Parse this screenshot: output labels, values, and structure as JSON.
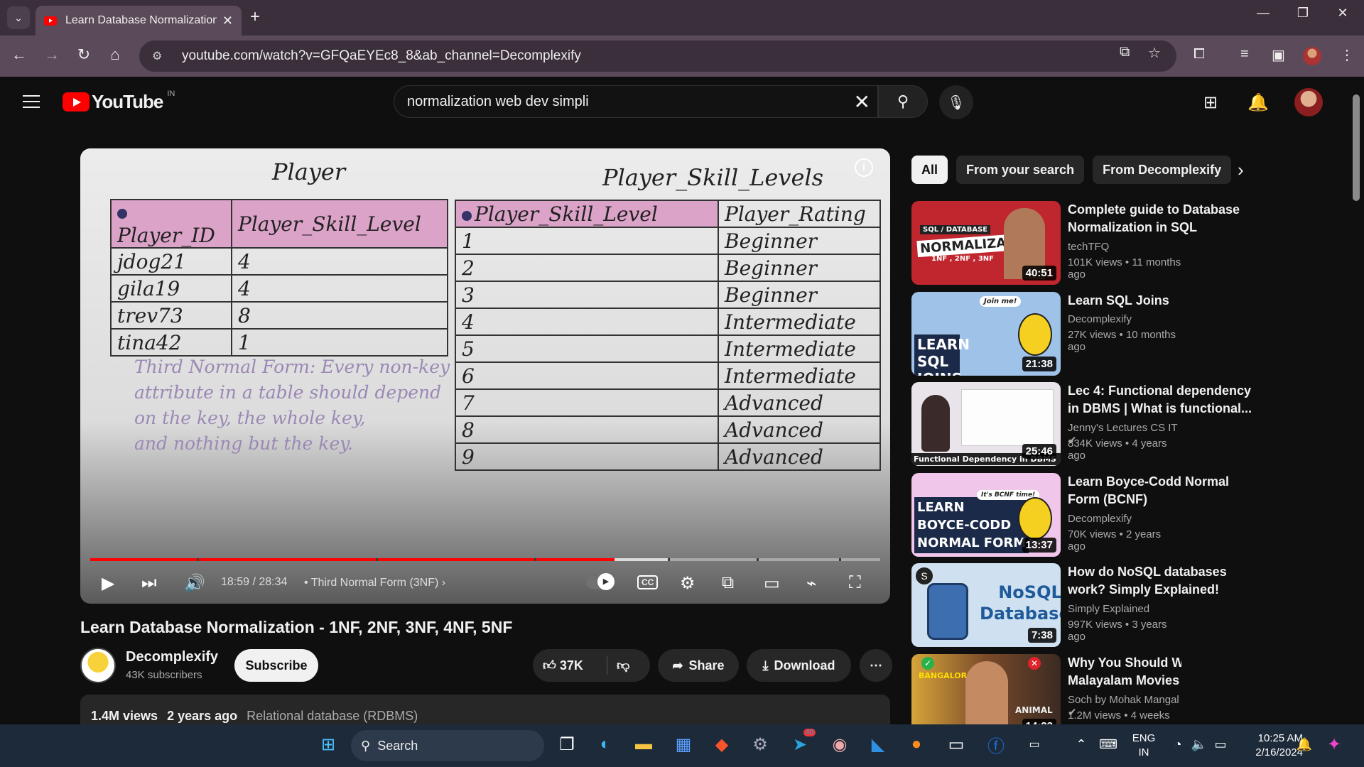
{
  "browser": {
    "tab_title": "Learn Database Normalization -",
    "url": "youtube.com/watch?v=GFQaEYEc8_8&ab_channel=Decomplexify"
  },
  "header": {
    "logo_text": "YouTube",
    "country": "IN",
    "search_value": "normalization web dev simpli"
  },
  "video": {
    "slide": {
      "left_title": "Player",
      "right_title": "Player_Skill_Levels",
      "left_headers": [
        "Player_ID",
        "Player_Skill_Level"
      ],
      "left_rows": [
        [
          "jdog21",
          "4"
        ],
        [
          "gila19",
          "4"
        ],
        [
          "trev73",
          "8"
        ],
        [
          "tina42",
          "1"
        ]
      ],
      "right_headers": [
        "Player_Skill_Level",
        "Player_Rating"
      ],
      "right_rows": [
        [
          "1",
          "Beginner"
        ],
        [
          "2",
          "Beginner"
        ],
        [
          "3",
          "Beginner"
        ],
        [
          "4",
          "Intermediate"
        ],
        [
          "5",
          "Intermediate"
        ],
        [
          "6",
          "Intermediate"
        ],
        [
          "7",
          "Advanced"
        ],
        [
          "8",
          "Advanced"
        ],
        [
          "9",
          "Advanced"
        ]
      ],
      "nf_text": [
        "Third Normal Form: Every non-key",
        "attribute in a table should depend",
        "on the key, the whole key,",
        "and nothing but the key."
      ]
    },
    "time": "18:59 / 28:34",
    "chapter": "• Third Normal Form (3NF)",
    "cc_label": "CC",
    "progress_played": 0.664,
    "progress_loaded": 0.732
  },
  "meta": {
    "title": "Learn Database Normalization - 1NF, 2NF, 3NF, 4NF, 5NF",
    "channel": "Decomplexify",
    "subscribers": "43K subscribers",
    "subscribe_label": "Subscribe",
    "likes": "37K",
    "share_label": "Share",
    "download_label": "Download",
    "views": "1.4M views",
    "age": "2 years ago",
    "tag": "Relational database (RDBMS)"
  },
  "chips": [
    "All",
    "From your search",
    "From Decomplexify"
  ],
  "recommendations": [
    {
      "title": "Complete guide to Database Normalization in SQL",
      "channel": "techTFQ",
      "verified": false,
      "views": "101K views",
      "age": "11 months ago",
      "duration": "40:51",
      "thumb_text": [
        "SQL / DATABASE",
        "NORMALIZATION",
        "1NF , 2NF , 3NF"
      ],
      "thumb_color": "#c0262d"
    },
    {
      "title": "Learn SQL Joins",
      "channel": "Decomplexify",
      "verified": false,
      "views": "27K views",
      "age": "10 months ago",
      "duration": "21:38",
      "thumb_text": [
        "LEARN",
        "SQL JOINS",
        "Join me!"
      ],
      "thumb_color": "#9fc3e8"
    },
    {
      "title": "Lec 4: Functional dependency in DBMS | What is functional...",
      "channel": "Jenny's Lectures CS IT",
      "verified": true,
      "views": "834K views",
      "age": "4 years ago",
      "duration": "25:46",
      "thumb_text": [
        "Functional Dependency in DBMS"
      ],
      "thumb_color": "#e9e4ea"
    },
    {
      "title": "Learn Boyce-Codd Normal Form (BCNF)",
      "channel": "Decomplexify",
      "verified": false,
      "views": "70K views",
      "age": "2 years ago",
      "duration": "13:37",
      "thumb_text": [
        "LEARN",
        "BOYCE-CODD",
        "NORMAL FORM",
        "It's BCNF time!"
      ],
      "thumb_color": "#f0c6ea"
    },
    {
      "title": "How do NoSQL databases work? Simply Explained!",
      "channel": "Simply Explained",
      "verified": false,
      "views": "997K views",
      "age": "3 years ago",
      "duration": "7:38",
      "thumb_text": [
        "NoSQL",
        "Databases"
      ],
      "thumb_color": "#cfe1f0"
    },
    {
      "title": "Why You Should Watch Malayalam Movies",
      "channel": "Soch by Mohak Mangal",
      "verified": true,
      "views": "1.2M views",
      "age": "4 weeks ago",
      "duration": "14:23",
      "thumb_text": [
        "BANGALORE",
        "ANIMAL"
      ],
      "thumb_color": "#7a4a2a"
    }
  ],
  "taskbar": {
    "search_label": "Search",
    "lang": [
      "ENG",
      "IN"
    ],
    "time": "10:25 AM",
    "date": "2/16/2024",
    "telegram_badge": "40"
  }
}
